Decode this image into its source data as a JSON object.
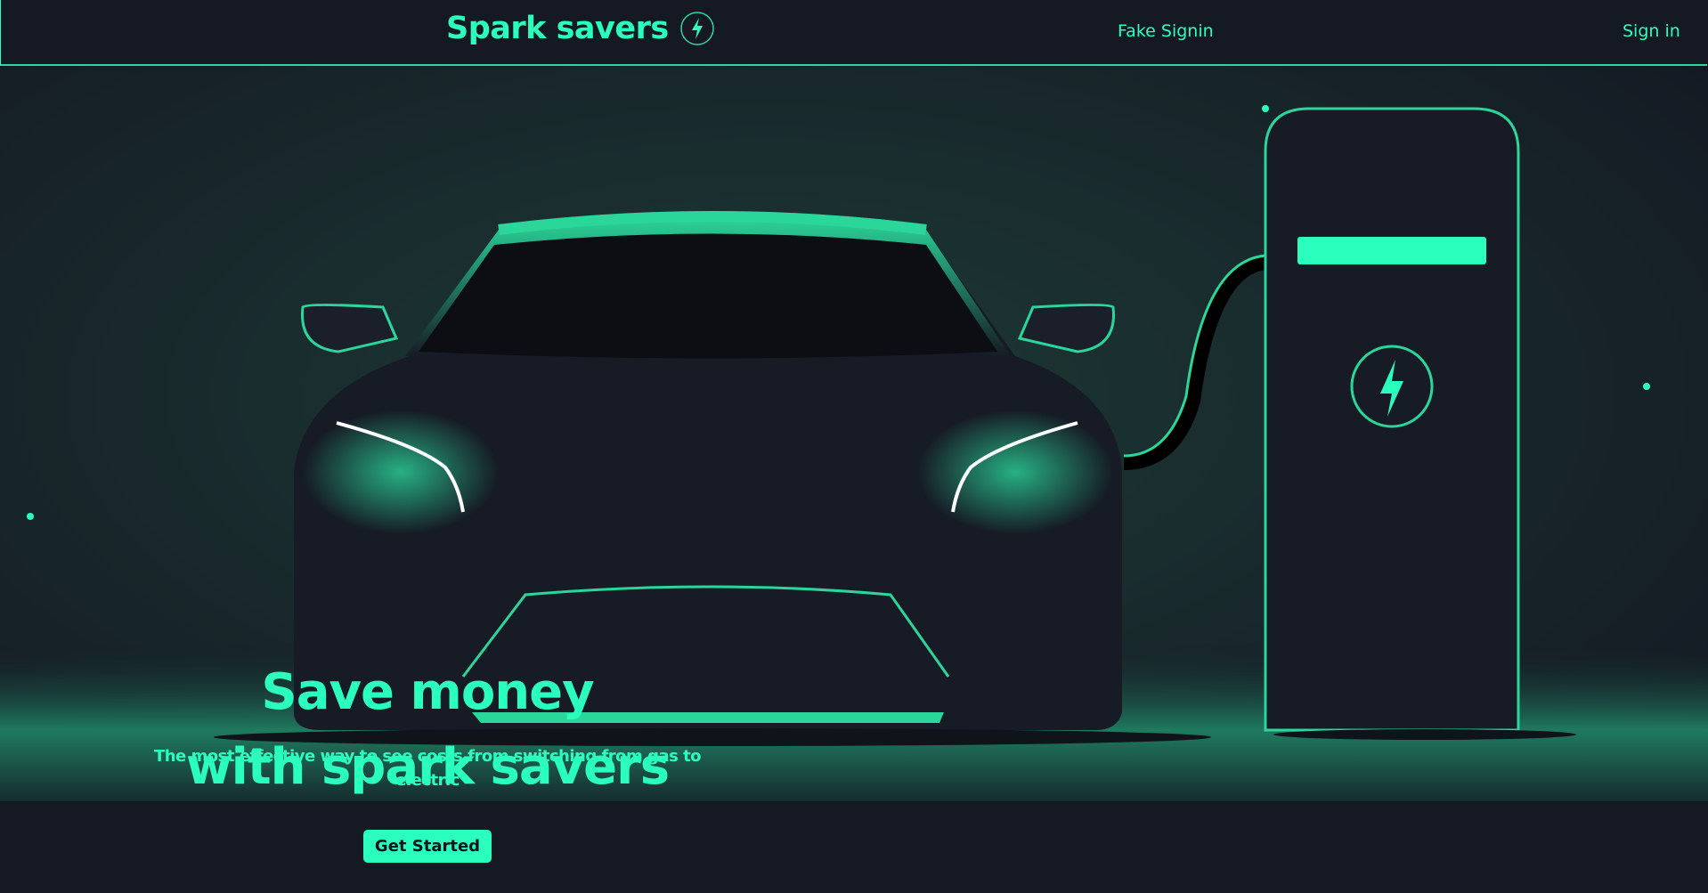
{
  "header": {
    "brand": "Spark savers",
    "brand_icon": "lightning-bolt-circle-icon",
    "nav": [
      {
        "label": "Fake Signin"
      },
      {
        "label": "Sign in"
      }
    ]
  },
  "hero": {
    "headline_line1": "Save money",
    "headline_line2": "with spark savers",
    "subtitle": "The most effective way to see costs from switching from gas to electric",
    "cta_label": "Get Started",
    "illustration_icon": "electric-car-charging-station-icon"
  },
  "colors": {
    "accent": "#2bffbe",
    "background": "#141923"
  }
}
